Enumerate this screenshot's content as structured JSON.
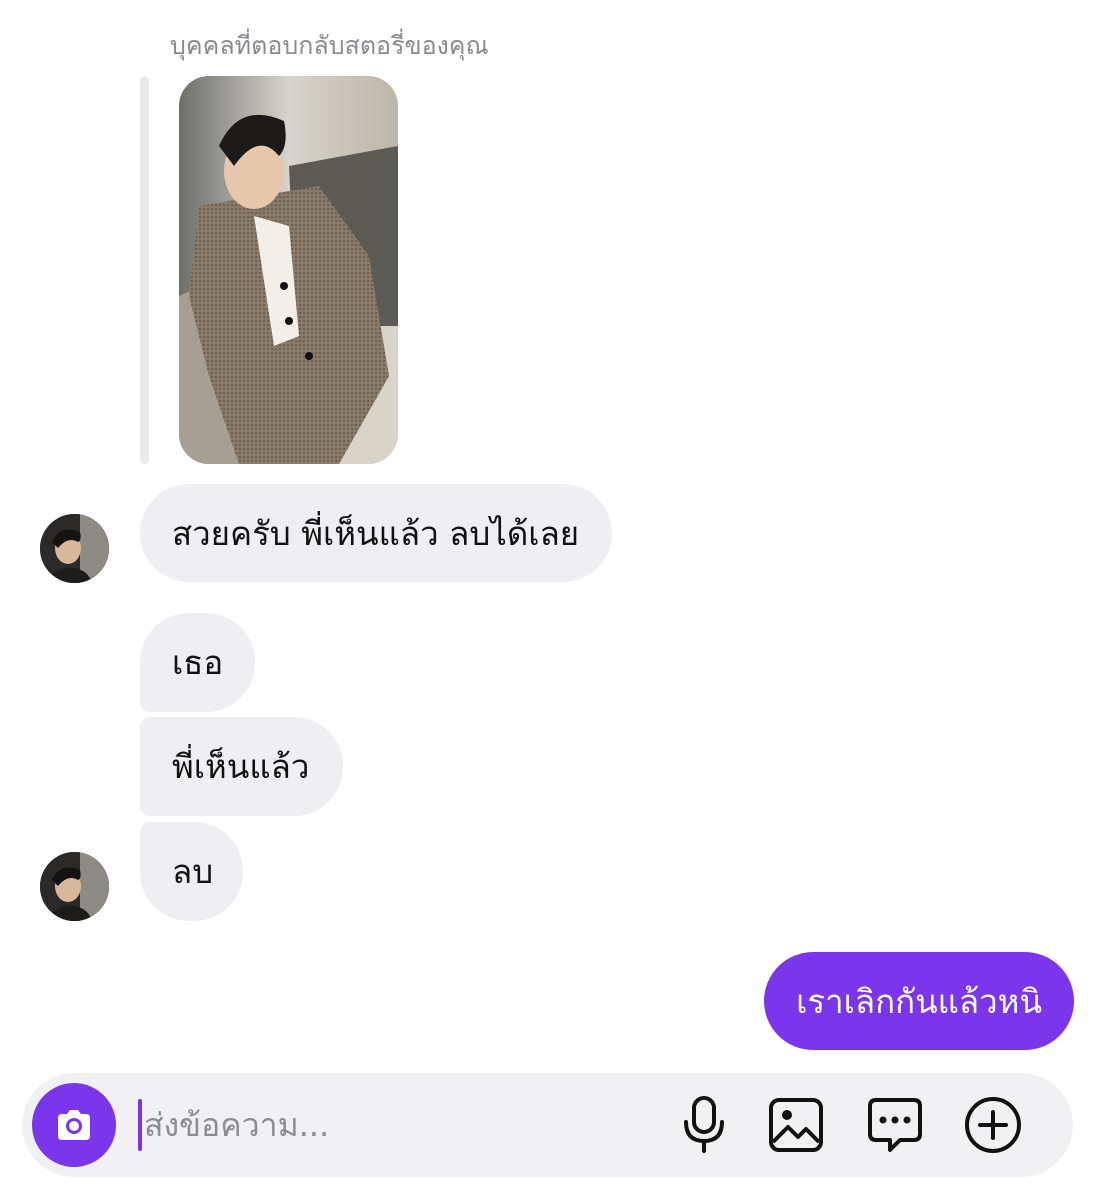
{
  "story_reply": {
    "caption": "บุคคลที่ตอบกลับสตอรี่ของคุณ"
  },
  "messages": [
    {
      "text": "สวยครับ พี่เห็นแล้ว ลบได้เลย"
    },
    {
      "text": "เธอ"
    },
    {
      "text": "พี่เห็นแล้ว"
    },
    {
      "text": "ลบ"
    },
    {
      "text": "เราเลิกกันแล้วหนิ"
    }
  ],
  "composer": {
    "placeholder": "ส่งข้อความ...",
    "icons": [
      "camera-icon",
      "microphone-icon",
      "image-icon",
      "sticker-icon",
      "plus-icon"
    ]
  },
  "colors": {
    "accent": "#7b36ec",
    "incoming_bubble": "#efeff3",
    "composer_bg": "#f1f1f4"
  }
}
